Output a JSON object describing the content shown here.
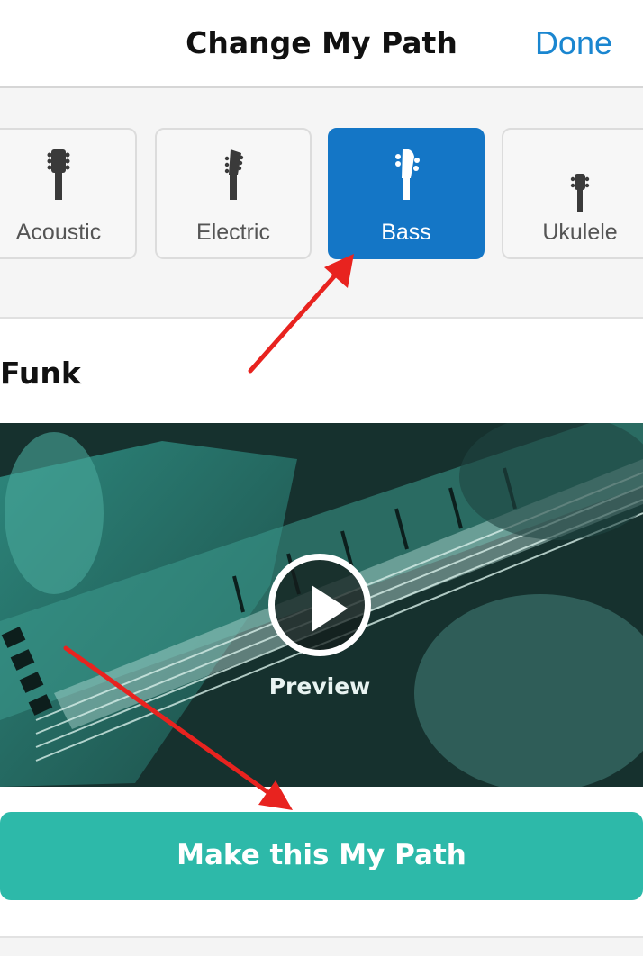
{
  "header": {
    "title": "Change My Path",
    "done_label": "Done"
  },
  "instruments": [
    {
      "label": "Acoustic",
      "icon": "acoustic-guitar-headstock-icon",
      "selected": false
    },
    {
      "label": "Electric",
      "icon": "electric-guitar-headstock-icon",
      "selected": false
    },
    {
      "label": "Bass",
      "icon": "bass-headstock-icon",
      "selected": true
    },
    {
      "label": "Ukulele",
      "icon": "ukulele-headstock-icon",
      "selected": false
    }
  ],
  "path": {
    "title": "Funk",
    "preview_label": "Preview",
    "cta_label": "Make this My Path"
  },
  "colors": {
    "accent_blue": "#1476c6",
    "done_blue": "#1a86d0",
    "cta_teal": "#2db9a9",
    "annotation_red": "#e8231f"
  }
}
